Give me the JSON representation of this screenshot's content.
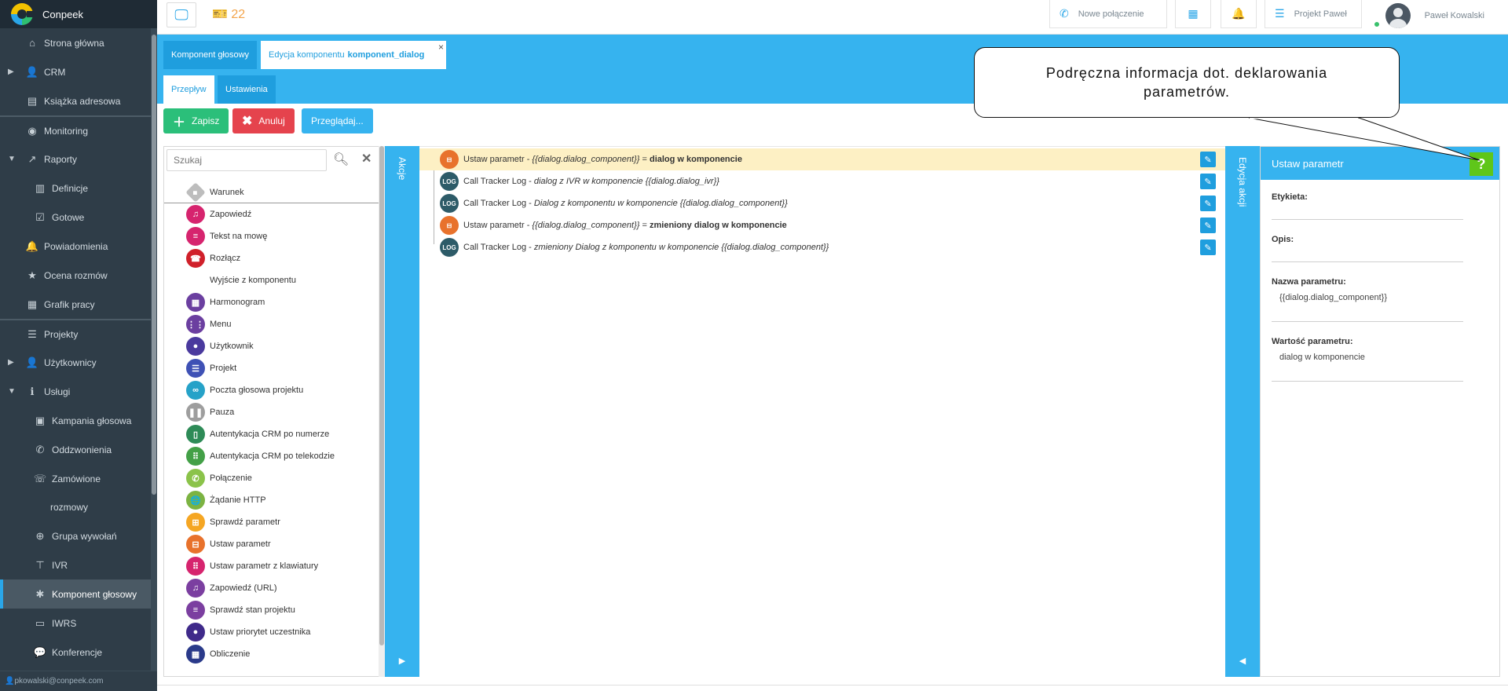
{
  "brand": {
    "name": "Conpeek"
  },
  "sidebar": {
    "items": [
      {
        "label": "Strona główna",
        "icon": "home-icon",
        "glyph": "⌂",
        "level": "top"
      },
      {
        "label": "CRM",
        "icon": "user-icon",
        "glyph": "👤",
        "level": "top",
        "caret": "▶"
      },
      {
        "label": "Książka adresowa",
        "icon": "address-book-icon",
        "glyph": "▤",
        "level": "top"
      },
      {
        "label": "Monitoring",
        "icon": "eye-icon",
        "glyph": "◉",
        "level": "top",
        "sep": true
      },
      {
        "label": "Raporty",
        "icon": "chart-icon",
        "glyph": "↗",
        "level": "top",
        "caret": "▼"
      },
      {
        "label": "Definicje",
        "icon": "bar-chart-icon",
        "glyph": "▥",
        "level": "sub"
      },
      {
        "label": "Gotowe",
        "icon": "checkbox-icon",
        "glyph": "☑",
        "level": "sub"
      },
      {
        "label": "Powiadomienia",
        "icon": "bell-icon",
        "glyph": "🔔",
        "level": "top"
      },
      {
        "label": "Ocena rozmów",
        "icon": "star-icon",
        "glyph": "★",
        "level": "top"
      },
      {
        "label": "Grafik pracy",
        "icon": "calendar-clock-icon",
        "glyph": "▦",
        "level": "top"
      },
      {
        "label": "Projekty",
        "icon": "list-check-icon",
        "glyph": "☰",
        "level": "top",
        "sep": true
      },
      {
        "label": "Użytkownicy",
        "icon": "user-icon",
        "glyph": "👤",
        "level": "top",
        "caret": "▶"
      },
      {
        "label": "Usługi",
        "icon": "info-icon",
        "glyph": "ℹ",
        "level": "top",
        "caret": "▼"
      },
      {
        "label": "Kampania głosowa",
        "icon": "contact-card-icon",
        "glyph": "▣",
        "level": "sub"
      },
      {
        "label": "Oddzwonienia",
        "icon": "phone-icon",
        "glyph": "✆",
        "level": "sub"
      },
      {
        "label": "Zamówione",
        "icon": "phone-ring-icon",
        "glyph": "☏",
        "level": "sub"
      },
      {
        "label": "rozmowy",
        "icon": "",
        "glyph": "",
        "level": "cont"
      },
      {
        "label": "Grupa wywołań",
        "icon": "crosshair-icon",
        "glyph": "⊕",
        "level": "sub"
      },
      {
        "label": "IVR",
        "icon": "sitemap-icon",
        "glyph": "⊤",
        "level": "sub"
      },
      {
        "label": "Komponent głosowy",
        "icon": "puzzle-icon",
        "glyph": "✱",
        "level": "sub",
        "active": true
      },
      {
        "label": "IWRS",
        "icon": "message-icon",
        "glyph": "▭",
        "level": "sub"
      },
      {
        "label": "Konferencje",
        "icon": "chat-icon",
        "glyph": "💬",
        "level": "sub"
      }
    ],
    "footer_user": "pkowalski@conpeek.com"
  },
  "topbar": {
    "tickets_count": "22",
    "new_call_label": "Nowe połączenie",
    "project_label": "Projekt Paweł",
    "user_name": "Paweł Kowalski"
  },
  "tabs": {
    "component": "Komponent głosowy",
    "edit_prefix": "Edycja komponentu",
    "edit_name": "komponent_dialog",
    "close": "×"
  },
  "subtabs": {
    "flow": "Przepływ",
    "settings": "Ustawienia"
  },
  "buttons": {
    "save": "Zapisz",
    "cancel": "Anuluj",
    "browse": "Przeglądaj..."
  },
  "search": {
    "placeholder": "Szukaj",
    "value": ""
  },
  "actions_panel": {
    "title": "Akcje",
    "items": [
      {
        "label": "Warunek",
        "color": "#bdbdbd",
        "glyph": "◆"
      },
      {
        "label": "Zapowiedź",
        "color": "#d6246e",
        "glyph": "♫"
      },
      {
        "label": "Tekst na mowę",
        "color": "#d6246e",
        "glyph": "≡"
      },
      {
        "label": "Rozłącz",
        "color": "#d0202a",
        "glyph": "☎"
      },
      {
        "label": "Wyjście z komponentu",
        "color": "",
        "glyph": ""
      },
      {
        "label": "Harmonogram",
        "color": "#6b3fa0",
        "glyph": "▦"
      },
      {
        "label": "Menu",
        "color": "#6b3fa0",
        "glyph": "⋮⋮"
      },
      {
        "label": "Użytkownik",
        "color": "#4a3a9e",
        "glyph": "●"
      },
      {
        "label": "Projekt",
        "color": "#3f51b5",
        "glyph": "☰"
      },
      {
        "label": "Poczta głosowa projektu",
        "color": "#26a2c8",
        "glyph": "∞"
      },
      {
        "label": "Pauza",
        "color": "#9e9e9e",
        "glyph": "❚❚"
      },
      {
        "label": "Autentykacja CRM po numerze",
        "color": "#2e8b57",
        "glyph": "▯"
      },
      {
        "label": "Autentykacja CRM po telekodzie",
        "color": "#43a047",
        "glyph": "⠿"
      },
      {
        "label": "Połączenie",
        "color": "#8bc34a",
        "glyph": "✆"
      },
      {
        "label": "Żądanie HTTP",
        "color": "#7cb342",
        "glyph": "🌐"
      },
      {
        "label": "Sprawdź parametr",
        "color": "#f5a623",
        "glyph": "⊞"
      },
      {
        "label": "Ustaw parametr",
        "color": "#e8722c",
        "glyph": "⊟"
      },
      {
        "label": "Ustaw parametr z klawiatury",
        "color": "#d6246e",
        "glyph": "⠿"
      },
      {
        "label": "Zapowiedź (URL)",
        "color": "#7b3fa0",
        "glyph": "♫"
      },
      {
        "label": "Sprawdź stan projektu",
        "color": "#7b3fa0",
        "glyph": "≡"
      },
      {
        "label": "Ustaw priorytet uczestnika",
        "color": "#3f2a8a",
        "glyph": "●"
      },
      {
        "label": "Obliczenie",
        "color": "#2a3a8a",
        "glyph": "▦"
      }
    ]
  },
  "flow": {
    "rows": [
      {
        "type": "set",
        "text_plain": "Ustaw parametr - ",
        "text_italic": "{{dialog.dialog_component}}",
        "text_sep": " = ",
        "text_bold": "dialog w komponencie",
        "highlight": true
      },
      {
        "type": "log",
        "text_plain": "Call Tracker Log - ",
        "text_italic": "dialog z IVR w komponencie {{dialog.dialog_ivr}}",
        "text_sep": "",
        "text_bold": ""
      },
      {
        "type": "log",
        "text_plain": "Call Tracker Log - ",
        "text_italic": "Dialog z komponentu w komponencie {{dialog.dialog_component}}",
        "text_sep": "",
        "text_bold": ""
      },
      {
        "type": "set",
        "text_plain": "Ustaw parametr - ",
        "text_italic": "{{dialog.dialog_component}}",
        "text_sep": " = ",
        "text_bold": "zmieniony dialog w komponencie"
      },
      {
        "type": "log",
        "text_plain": "Call Tracker Log - ",
        "text_italic": "zmieniony Dialog z komponentu w komponencie {{dialog.dialog_component}}",
        "text_sep": "",
        "text_bold": ""
      }
    ],
    "log_badge": "LOG"
  },
  "edit_panel": {
    "strip_title": "Edycja akcji",
    "title": "Ustaw parametr",
    "help": "?",
    "label_label": "Etykieta:",
    "label_value": "",
    "desc_label": "Opis:",
    "desc_value": "",
    "name_label": "Nazwa parametru:",
    "name_value": "{{dialog.dialog_component}}",
    "value_label": "Wartość parametru:",
    "value_value": "dialog w komponencie"
  },
  "callout": {
    "text": "Podręczna informacja dot. deklarowania parametrów."
  },
  "colors": {
    "accent": "#36b3ef",
    "sidebar": "#2f3d48",
    "save": "#2bbf7a",
    "cancel": "#e5434d",
    "help": "#5fc61a",
    "highlight": "#fdf0c4"
  }
}
